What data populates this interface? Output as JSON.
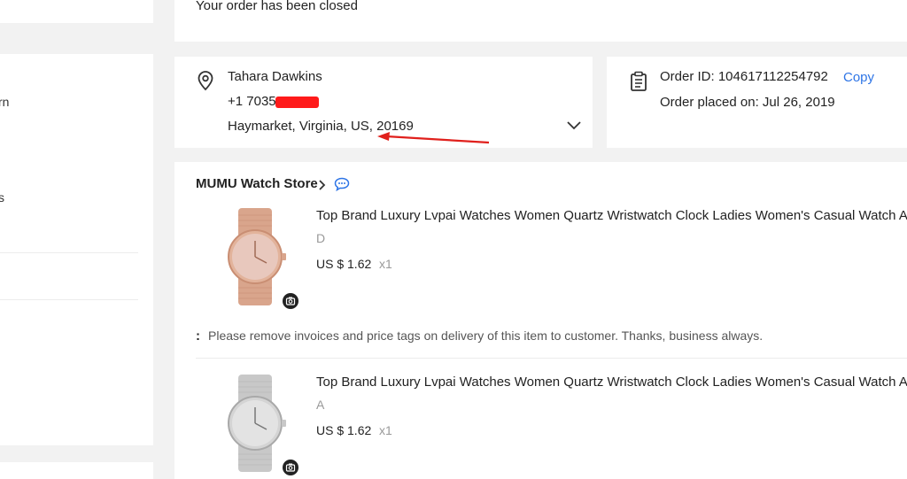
{
  "status": {
    "message": "Your order has been closed"
  },
  "left_nav": {
    "items": [
      {
        "label": "rn"
      },
      {
        "label": "s"
      }
    ]
  },
  "address": {
    "name": "Tahara Dawkins",
    "phone": "+1 7035",
    "location": "Haymarket, Virginia, US, 20169",
    "icon": "location-pin-icon",
    "expand_icon": "chevron-down-icon"
  },
  "order": {
    "id_label": "Order ID: 104617112254792",
    "copy_label": "Copy",
    "placed_label": "Order placed on: Jul 26, 2019",
    "icon": "clipboard-icon"
  },
  "store": {
    "name": "MUMU Watch Store",
    "chevron": ">",
    "chat_icon": "chat-bubble-icon"
  },
  "items": [
    {
      "title": "Top Brand Luxury Lvpai Watches Women Quartz Wristwatch Clock Ladies Women's Casual Watch Analo",
      "variant": "D",
      "price": "US $ 1.62",
      "qty": "x1",
      "strap_color": "#d9a58c"
    },
    {
      "title": "Top Brand Luxury Lvpai Watches Women Quartz Wristwatch Clock Ladies Women's Casual Watch Analo",
      "variant": "A",
      "price": "US $ 1.62",
      "qty": "x1",
      "strap_color": "#c8c8c8"
    }
  ],
  "note": {
    "prefix": ":",
    "text": "Please remove invoices and price tags on delivery of this item to customer. Thanks, business always."
  },
  "colors": {
    "link": "#2e75e6",
    "redaction": "#ff1a1a",
    "annotation_arrow": "#e0201c"
  }
}
